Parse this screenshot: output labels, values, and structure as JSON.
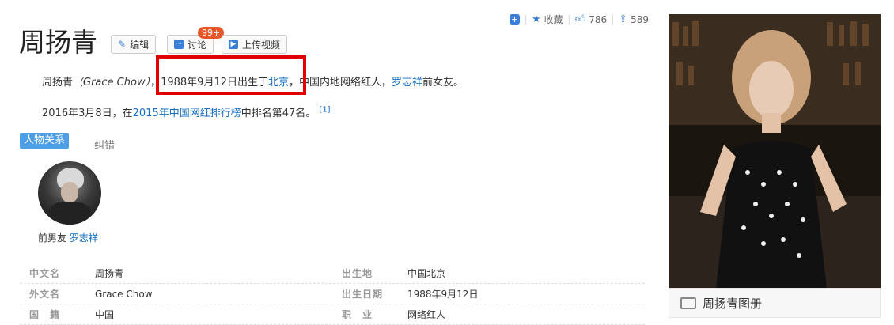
{
  "header": {
    "title": "周扬青",
    "edit_label": "编辑",
    "discuss_label": "讨论",
    "discuss_badge": "99+",
    "upload_video_label": "上传视频"
  },
  "topbar": {
    "favorite_label": "收藏",
    "like_count": "786",
    "share_count": "589"
  },
  "summary": {
    "p1_name": "周扬青",
    "p1_en": "（Grace Chow）",
    "p1_birth": "，1988年9月12日出生于",
    "p1_birth_place_link": "北京",
    "p1_rest": "，中国内地网络红人，",
    "p1_partner_link": "罗志祥",
    "p1_end": "前女友。",
    "p2_start": "2016年3月8日，在",
    "p2_link": "2015年中国网红排行榜",
    "p2_end": "中排名第47名。",
    "p2_ref": "[1]"
  },
  "tabs": {
    "active": "人物关系",
    "other": "纠错"
  },
  "relation": {
    "label": "前男友",
    "name": "罗志祥"
  },
  "info_table": [
    {
      "k1": "中文名",
      "v1": "周扬青",
      "k2": "出生地",
      "v2": "中国北京"
    },
    {
      "k1": "外文名",
      "v1": "Grace Chow",
      "k2": "出生日期",
      "v2": "1988年9月12日"
    },
    {
      "k1": "国　籍",
      "v1": "中国",
      "k2": "职　业",
      "v2": "网络红人"
    }
  ],
  "album": {
    "label": "周扬青图册"
  },
  "colors": {
    "link": "#136ec2",
    "accent": "#3a7fd6",
    "highlight_box": "#e10000",
    "badge": "#e6562a"
  }
}
